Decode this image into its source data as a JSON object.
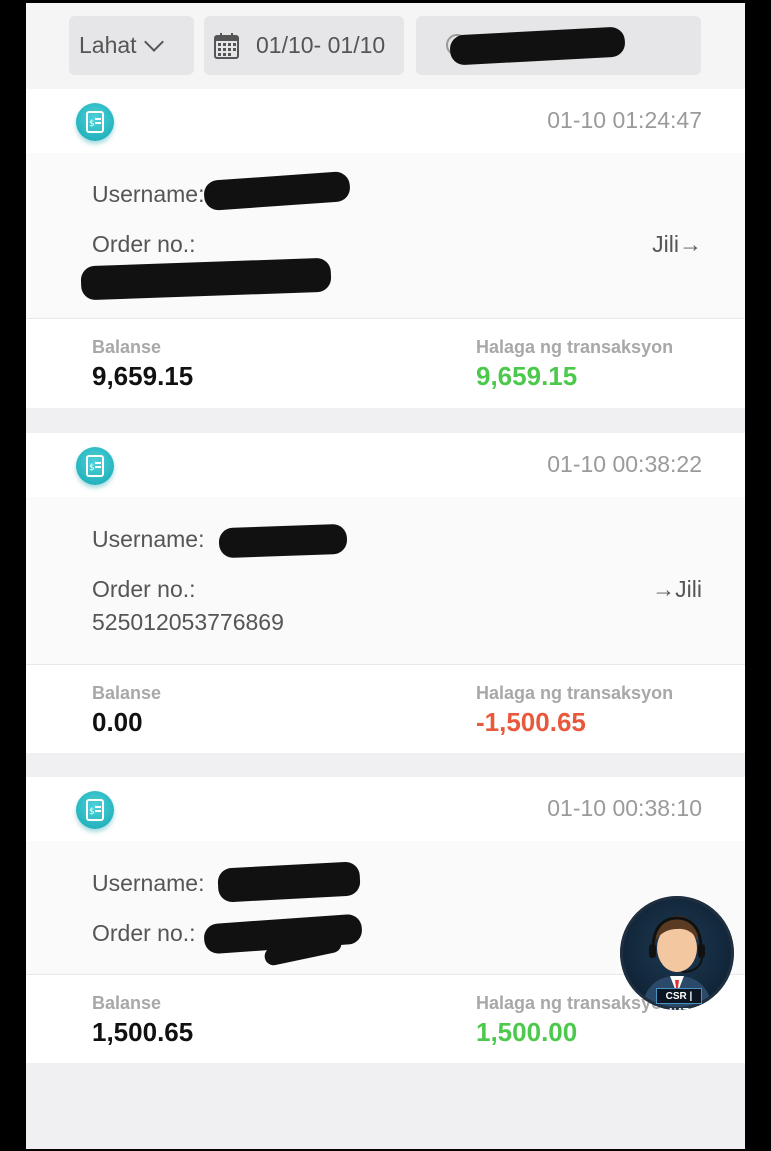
{
  "filters": {
    "type_label": "Lahat",
    "date_label": "01/10- 01/10"
  },
  "transactions": [
    {
      "time": "01-10 01:24:47",
      "username_label": "Username:",
      "order_label": "Order no.:",
      "transfer": "Jili→",
      "balance_label": "Balanse",
      "balance": "9,659.15",
      "amount_label": "Halaga ng transaksyon",
      "amount": "9,659.15",
      "amount_color": "#4cc94c"
    },
    {
      "time": "01-10 00:38:22",
      "username_label": "Username:",
      "order_label": "Order no.:",
      "order_no": "525012053776869",
      "transfer": "→Jili",
      "balance_label": "Balanse",
      "balance": "0.00",
      "amount_label": "Halaga ng transaksyon",
      "amount": "-1,500.65",
      "amount_color": "#e8593c"
    },
    {
      "time": "01-10 00:38:10",
      "username_label": "Username:",
      "order_label": "Order no.:",
      "balance_label": "Balanse",
      "balance": "1,500.65",
      "amount_label": "Halaga ng transaksyon",
      "amount": "1,500.00",
      "amount_color": "#4cc94c"
    }
  ],
  "support": {
    "badge": "CSR | NAT",
    "icon": "customer-support-agent-icon"
  }
}
